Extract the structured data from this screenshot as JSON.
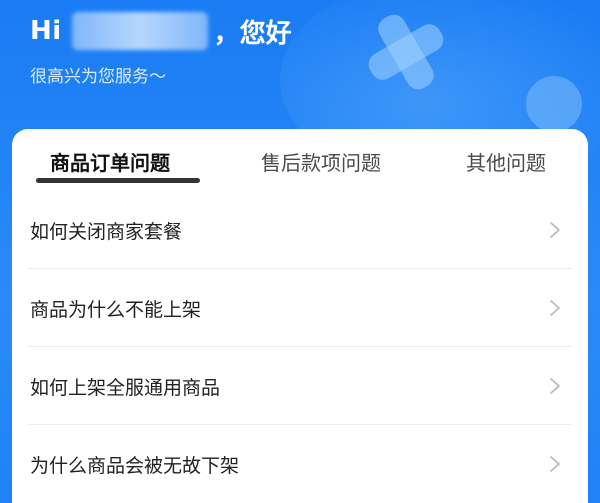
{
  "header": {
    "greeting_prefix": "Hi",
    "greeting_suffix": "，您好",
    "subtitle": "很高兴为您服务～"
  },
  "tabs": [
    {
      "label": "商品订单问题",
      "active": true
    },
    {
      "label": "售后款项问题",
      "active": false
    },
    {
      "label": "其他问题",
      "active": false
    }
  ],
  "questions": [
    {
      "label": "如何关闭商家套餐",
      "icon": "chevron-right-icon"
    },
    {
      "label": "商品为什么不能上架",
      "icon": "chevron-right-icon"
    },
    {
      "label": "如何上架全服通用商品",
      "icon": "chevron-right-icon"
    },
    {
      "label": "为什么商品会被无故下架",
      "icon": "chevron-right-icon"
    }
  ],
  "colors": {
    "background": "#1a7cf4",
    "card": "#ffffff",
    "active_tab_text": "#111111",
    "tab_underline": "#333333"
  }
}
